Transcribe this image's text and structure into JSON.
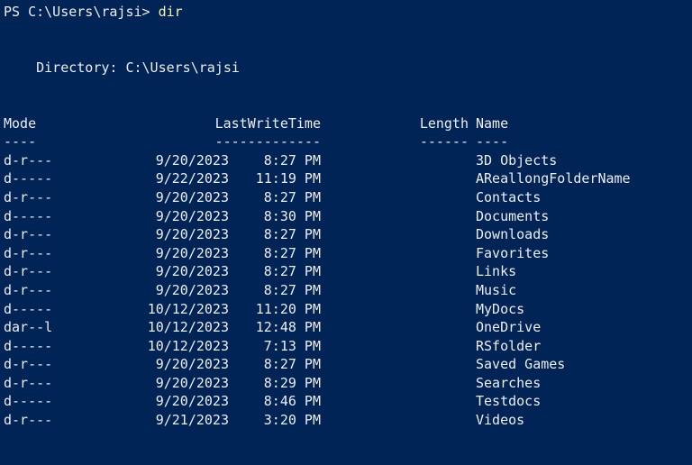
{
  "terminal": {
    "prompt": "PS C:\\Users\\rajsi> ",
    "command": "dir",
    "directory_line": "    Directory: C:\\Users\\rajsi",
    "headers": {
      "mode": "Mode",
      "lastwritetime": "LastWriteTime",
      "length": "Length",
      "name": "Name"
    },
    "separators": {
      "mode": "----",
      "lastwritetime": "-------------",
      "length": "------",
      "name": "----"
    },
    "rows": [
      {
        "mode": "d-r---",
        "date": "9/20/2023",
        "time": "8:27 PM",
        "length": "",
        "name": "3D Objects"
      },
      {
        "mode": "d-----",
        "date": "9/22/2023",
        "time": "11:19 PM",
        "length": "",
        "name": "AReallongFolderName"
      },
      {
        "mode": "d-r---",
        "date": "9/20/2023",
        "time": "8:27 PM",
        "length": "",
        "name": "Contacts"
      },
      {
        "mode": "d-----",
        "date": "9/20/2023",
        "time": "8:30 PM",
        "length": "",
        "name": "Documents"
      },
      {
        "mode": "d-r---",
        "date": "9/20/2023",
        "time": "8:27 PM",
        "length": "",
        "name": "Downloads"
      },
      {
        "mode": "d-r---",
        "date": "9/20/2023",
        "time": "8:27 PM",
        "length": "",
        "name": "Favorites"
      },
      {
        "mode": "d-r---",
        "date": "9/20/2023",
        "time": "8:27 PM",
        "length": "",
        "name": "Links"
      },
      {
        "mode": "d-r---",
        "date": "9/20/2023",
        "time": "8:27 PM",
        "length": "",
        "name": "Music"
      },
      {
        "mode": "d-----",
        "date": "10/12/2023",
        "time": "11:20 PM",
        "length": "",
        "name": "MyDocs"
      },
      {
        "mode": "dar--l",
        "date": "10/12/2023",
        "time": "12:48 PM",
        "length": "",
        "name": "OneDrive"
      },
      {
        "mode": "d-----",
        "date": "10/12/2023",
        "time": "7:13 PM",
        "length": "",
        "name": "RSfolder"
      },
      {
        "mode": "d-r---",
        "date": "9/20/2023",
        "time": "8:27 PM",
        "length": "",
        "name": "Saved Games"
      },
      {
        "mode": "d-r---",
        "date": "9/20/2023",
        "time": "8:29 PM",
        "length": "",
        "name": "Searches"
      },
      {
        "mode": "d-----",
        "date": "9/20/2023",
        "time": "8:46 PM",
        "length": "",
        "name": "Testdocs"
      },
      {
        "mode": "d-r---",
        "date": "9/21/2023",
        "time": "3:20 PM",
        "length": "",
        "name": "Videos"
      }
    ]
  },
  "colors": {
    "background": "#012456",
    "foreground": "#eeedf0",
    "command": "#f9f1a5",
    "edge": "#f5d400"
  }
}
